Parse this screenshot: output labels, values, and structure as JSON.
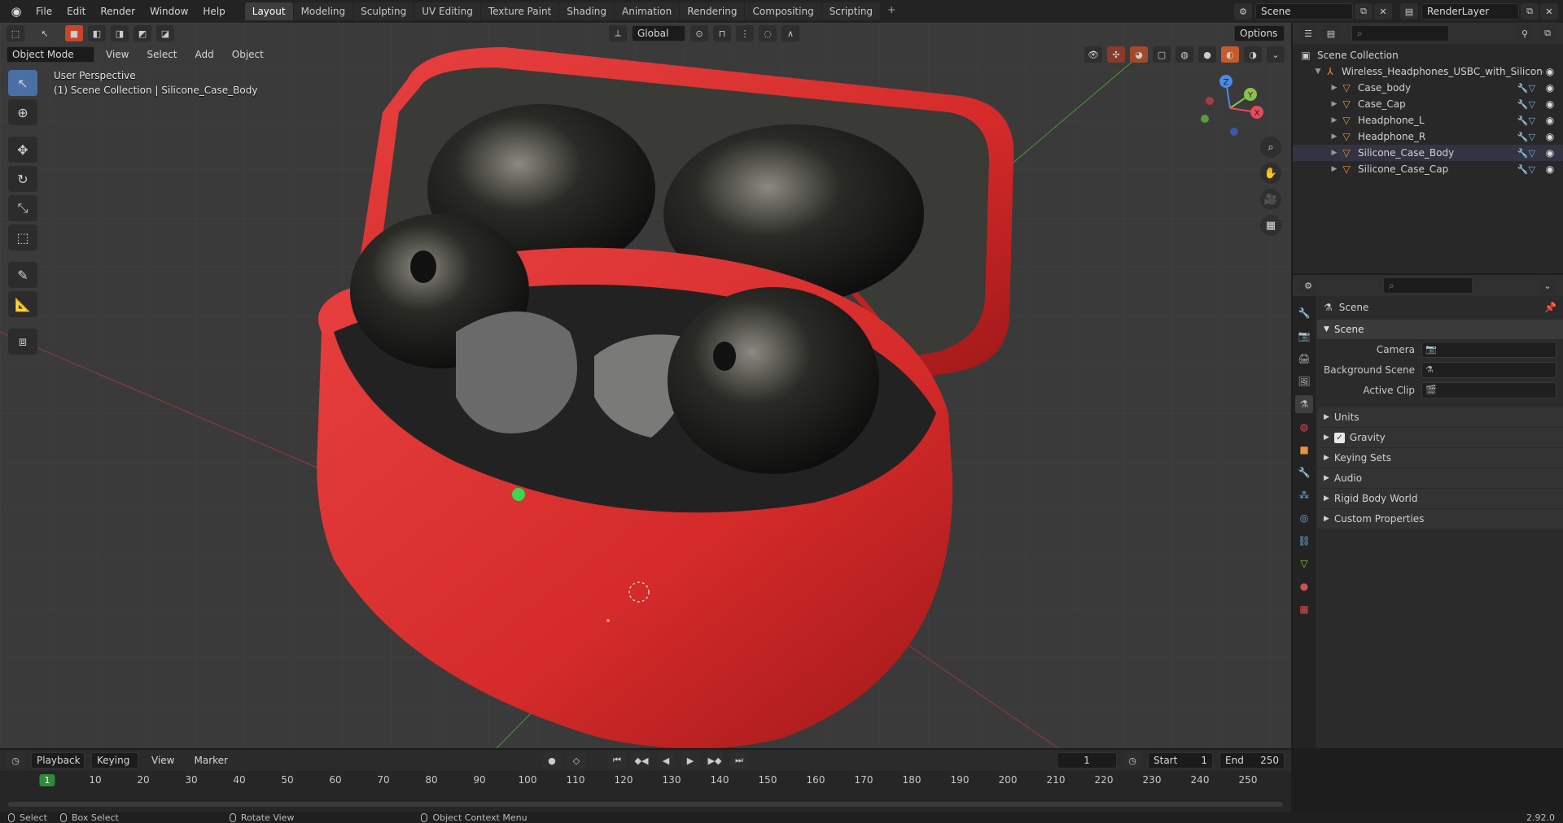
{
  "menu": {
    "items": [
      "File",
      "Edit",
      "Render",
      "Window",
      "Help"
    ]
  },
  "workspaces": {
    "tabs": [
      "Layout",
      "Modeling",
      "Sculpting",
      "UV Editing",
      "Texture Paint",
      "Shading",
      "Animation",
      "Rendering",
      "Compositing",
      "Scripting"
    ],
    "active": "Layout",
    "add": "+"
  },
  "scene_selector": {
    "value": "Scene"
  },
  "view_layer": {
    "value": "RenderLayer"
  },
  "viewport": {
    "mode": "Object Mode",
    "menus": [
      "View",
      "Select",
      "Add",
      "Object"
    ],
    "transform_orientation": "Global",
    "options_label": "Options",
    "info_line1": "User Perspective",
    "info_line2": "(1) Scene Collection | Silicone_Case_Body",
    "gizmo": {
      "x": "X",
      "y": "Y",
      "z": "Z"
    }
  },
  "outliner": {
    "root": "Scene Collection",
    "collection": "Wireless_Headphones_USBC_with_Silicone_(",
    "objects": [
      "Case_body",
      "Case_Cap",
      "Headphone_L",
      "Headphone_R",
      "Silicone_Case_Body",
      "Silicone_Case_Cap"
    ]
  },
  "properties": {
    "context_title": "Scene",
    "panel_title": "Scene",
    "rows": [
      {
        "label": "Camera"
      },
      {
        "label": "Background Scene"
      },
      {
        "label": "Active Clip"
      }
    ],
    "subpanels": [
      "Units",
      "Gravity",
      "Keying Sets",
      "Audio",
      "Rigid Body World",
      "Custom Properties"
    ]
  },
  "timeline": {
    "menus": [
      "Playback",
      "Keying",
      "View",
      "Marker"
    ],
    "current_frame": "1",
    "start_label": "Start",
    "start_value": "1",
    "end_label": "End",
    "end_value": "250",
    "ticks": [
      "10",
      "20",
      "30",
      "40",
      "50",
      "60",
      "70",
      "80",
      "90",
      "100",
      "110",
      "120",
      "130",
      "140",
      "150",
      "160",
      "170",
      "180",
      "190",
      "200",
      "210",
      "220",
      "230",
      "240",
      "250"
    ],
    "playhead": "1"
  },
  "statusbar": {
    "select": "Select",
    "box_select": "Box Select",
    "rotate_view": "Rotate View",
    "context_menu": "Object Context Menu",
    "version": "2.92.0"
  },
  "colors": {
    "case_red": "#e03030",
    "accent_blue": "#4a6fa5",
    "object_orange": "#e8953a",
    "playhead_green": "#2c8a3a"
  }
}
